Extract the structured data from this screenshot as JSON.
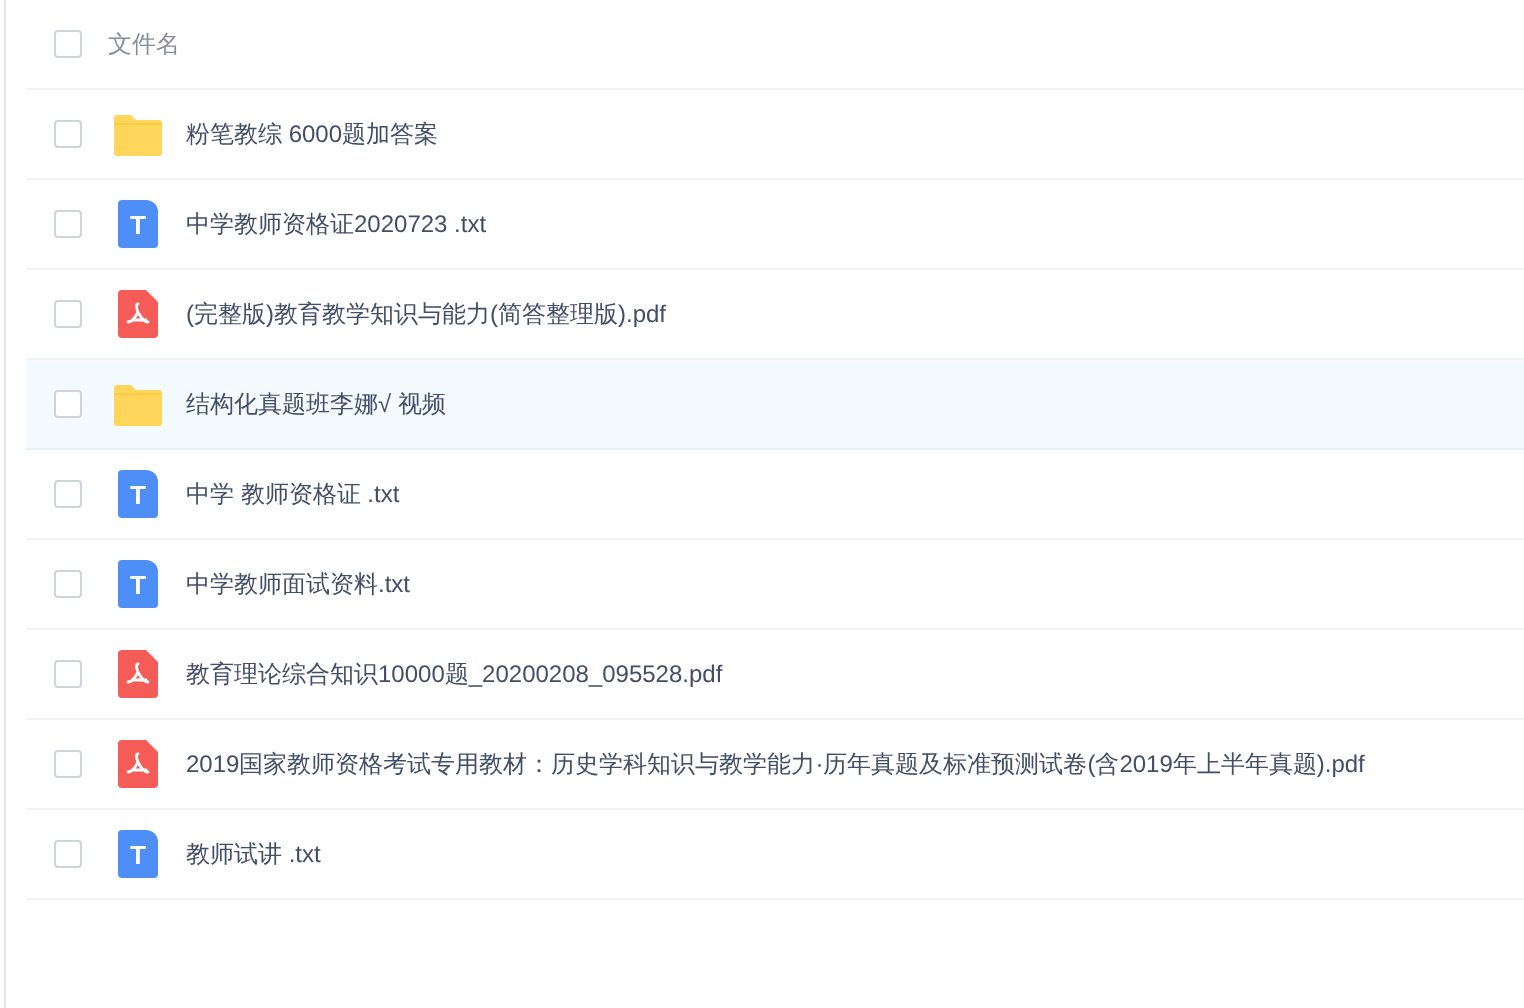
{
  "header": {
    "checked": false,
    "label": "文件名"
  },
  "files": [
    {
      "kind": "folder",
      "name": "粉笔教综 6000题加答案",
      "checked": false,
      "highlighted": false
    },
    {
      "kind": "txt",
      "icon_text": "T",
      "name": "中学教师资格证2020723 .txt",
      "checked": false,
      "highlighted": false
    },
    {
      "kind": "pdf",
      "name": "(完整版)教育教学知识与能力(简答整理版).pdf",
      "checked": false,
      "highlighted": false
    },
    {
      "kind": "folder",
      "name": "结构化真题班李娜√ 视频",
      "checked": false,
      "highlighted": true
    },
    {
      "kind": "txt",
      "icon_text": "T",
      "name": "中学 教师资格证 .txt",
      "checked": false,
      "highlighted": false
    },
    {
      "kind": "txt",
      "icon_text": "T",
      "name": "中学教师面试资料.txt",
      "checked": false,
      "highlighted": false
    },
    {
      "kind": "pdf",
      "name": "教育理论综合知识10000题_20200208_095528.pdf",
      "checked": false,
      "highlighted": false
    },
    {
      "kind": "pdf",
      "name": "2019国家教师资格考试专用教材：历史学科知识与教学能力·历年真题及标准预测试卷(含2019年上半年真题).pdf",
      "checked": false,
      "highlighted": false
    },
    {
      "kind": "txt",
      "icon_text": "T",
      "name": "教师试讲 .txt",
      "checked": false,
      "highlighted": false
    }
  ]
}
